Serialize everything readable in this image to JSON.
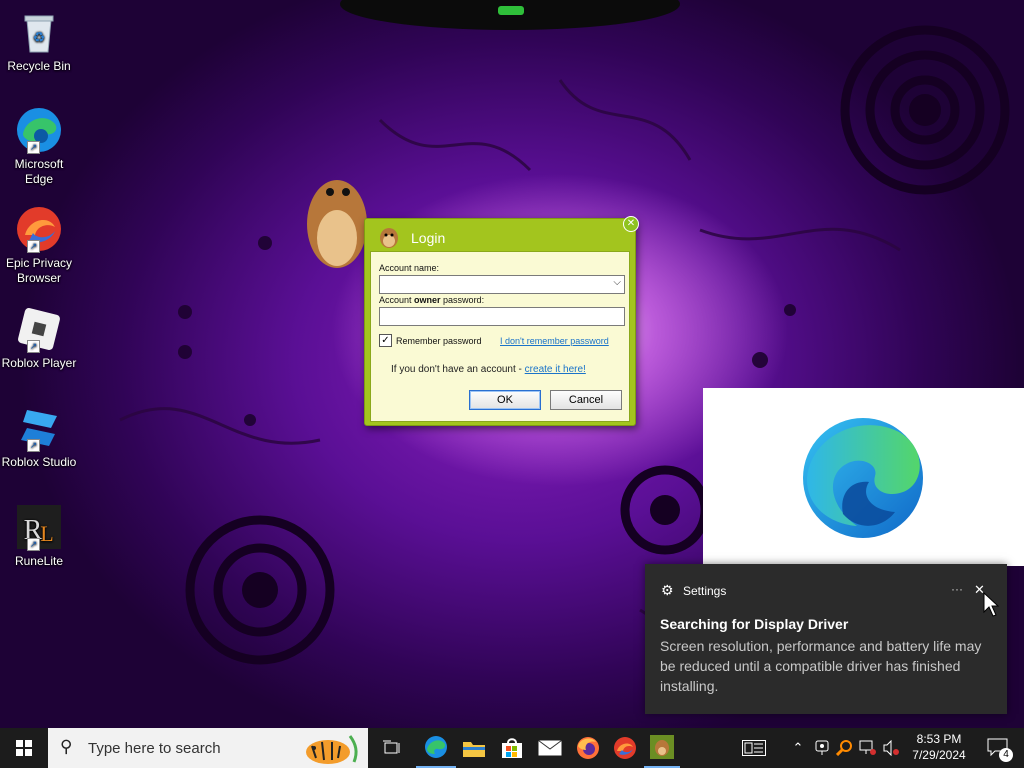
{
  "desktop_icons": [
    {
      "label": "Recycle Bin",
      "icon": "recycle-bin-icon"
    },
    {
      "label": "Microsoft Edge",
      "icon": "edge-icon"
    },
    {
      "label": "Epic Privacy Browser",
      "icon": "epic-browser-icon"
    },
    {
      "label": "Roblox Player",
      "icon": "roblox-player-icon"
    },
    {
      "label": "Roblox Studio",
      "icon": "roblox-studio-icon"
    },
    {
      "label": "RuneLite",
      "icon": "runelite-icon"
    }
  ],
  "login": {
    "title": "Login",
    "account_name_label": "Account name:",
    "account_name_value": "",
    "owner_password_prefix": "Account ",
    "owner_password_bold": "owner",
    "owner_password_suffix": " password:",
    "owner_password_value": "",
    "remember_label": "Remember password",
    "remember_checked": true,
    "forgot_link": "I don't remember password",
    "no_account_text": "If you don't have an account - ",
    "create_link": "create it here!",
    "ok_label": "OK",
    "cancel_label": "Cancel"
  },
  "toast": {
    "app_name": "Settings",
    "more_label": "···",
    "close_label": "✕",
    "title": "Searching for Display Driver",
    "body": "Screen resolution, performance and battery life may be reduced until a compatible driver has finished installing."
  },
  "taskbar": {
    "search_placeholder": "Type here to search",
    "time": "8:53 PM",
    "date": "7/29/2024",
    "notification_count": "4",
    "accent": "#0078d7"
  }
}
